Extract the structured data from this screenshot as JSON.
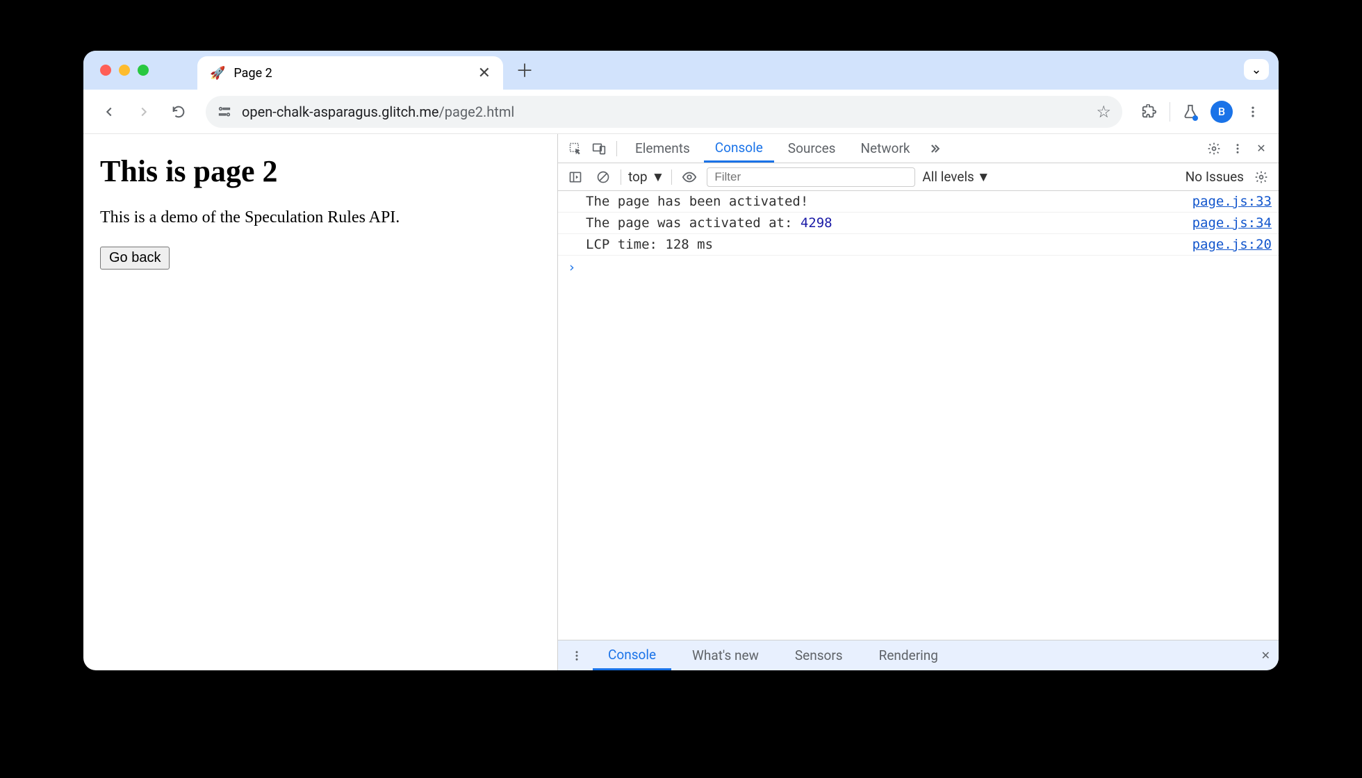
{
  "browser": {
    "tab": {
      "icon": "🚀",
      "title": "Page 2"
    },
    "url_host": "open-chalk-asparagus.glitch.me",
    "url_path": "/page2.html",
    "avatar_letter": "B"
  },
  "page": {
    "heading": "This is page 2",
    "paragraph": "This is a demo of the Speculation Rules API.",
    "button": "Go back"
  },
  "devtools": {
    "tabs": [
      "Elements",
      "Console",
      "Sources",
      "Network"
    ],
    "active_tab": "Console",
    "console_toolbar": {
      "context": "top",
      "filter_placeholder": "Filter",
      "levels": "All levels",
      "issues": "No Issues"
    },
    "logs": [
      {
        "msg_pre": "The page has been activated!",
        "num": "",
        "src": "page.js:33"
      },
      {
        "msg_pre": "The page was activated at: ",
        "num": "4298",
        "src": "page.js:34"
      },
      {
        "msg_pre": "LCP time: 128 ms",
        "num": "",
        "src": "page.js:20"
      }
    ],
    "drawer_tabs": [
      "Console",
      "What's new",
      "Sensors",
      "Rendering"
    ],
    "drawer_active": "Console"
  }
}
